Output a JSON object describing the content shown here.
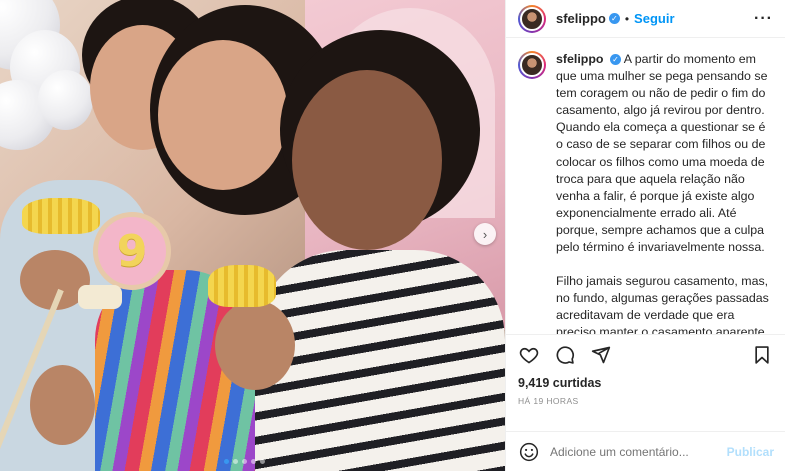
{
  "post": {
    "username": "sfelippo",
    "follow_label": "Seguir",
    "bullet": "•",
    "more_icon": "more-horizontal-icon",
    "caption": {
      "paragraph1": "A partir do momento em que uma mulher se pega pensando se tem coragem ou não de pedir o fim do casamento, algo já revirou por dentro. Quando ela começa a questionar se é o caso de se separar com filhos ou de colocar os filhos como uma moeda de troca para que aquela relação não venha a falir, é porque já existe algo exponencialmente errado ali. Até porque, sempre achamos que a culpa pelo término é invariavelmente nossa.",
      "paragraph2": "Filho jamais segurou casamento, mas, no fundo, algumas gerações passadas acreditavam de verdade que era preciso manter o casamento aparente"
    },
    "likes": "9,419 curtidas",
    "time": "HÁ 19 HORAS",
    "comment_placeholder": "Adicione um comentário...",
    "publish_label": "Publicar",
    "media": {
      "lollipop_number": "9",
      "next_icon": "chevron-right-icon",
      "carousel_active_index": 0,
      "carousel_count": 5
    },
    "colors": {
      "accent": "#0095f6",
      "verified": "#3897f0",
      "publish_disabled": "#b2dffc"
    }
  }
}
